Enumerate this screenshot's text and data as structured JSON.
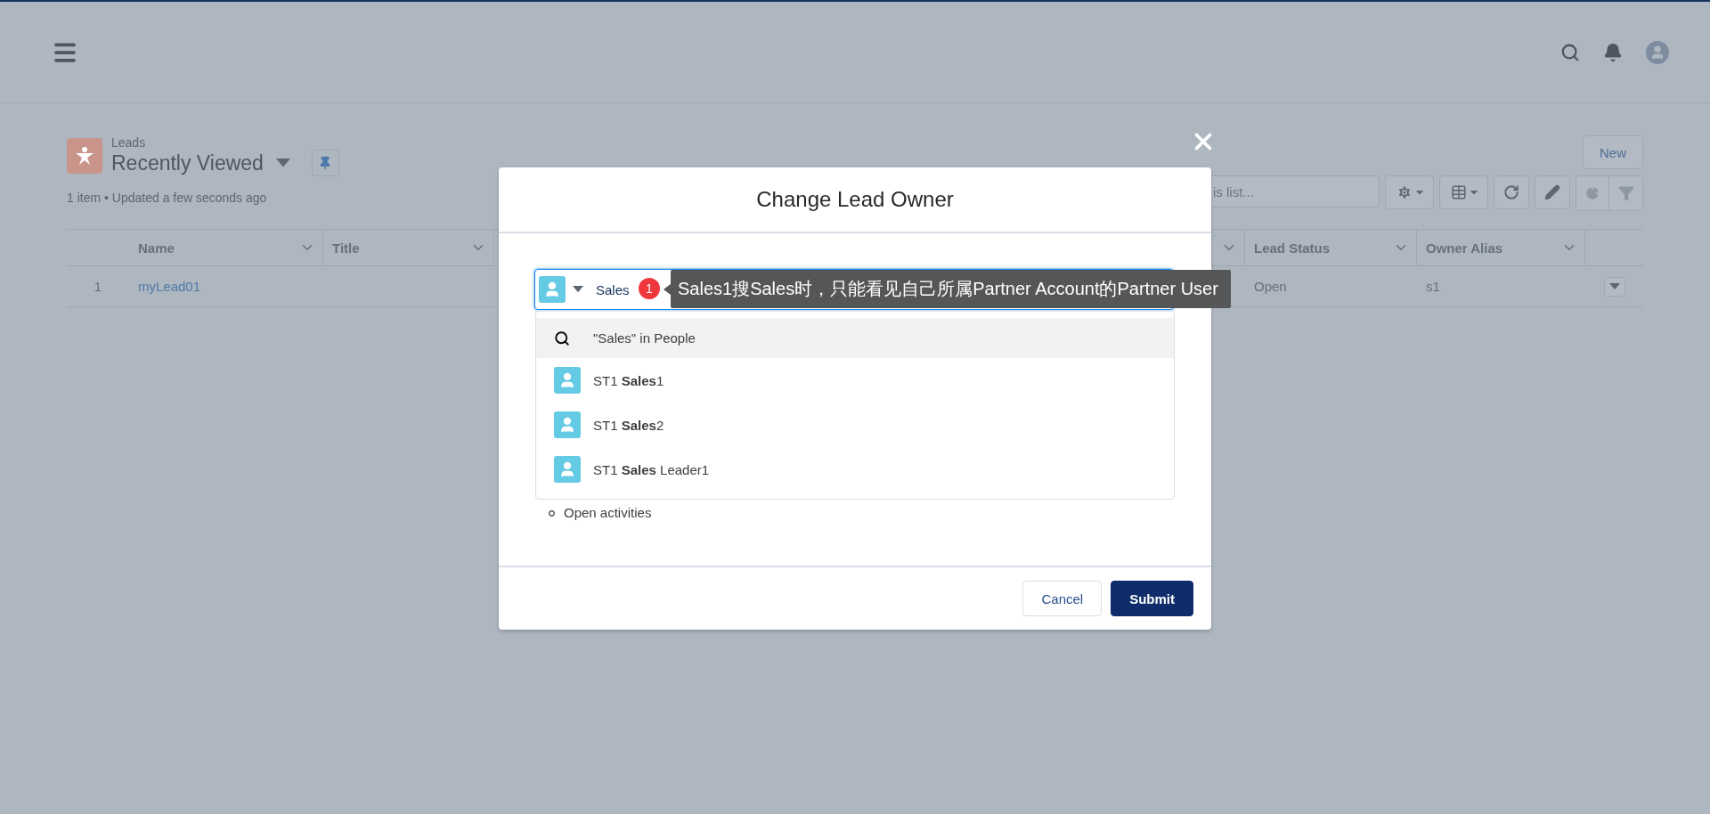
{
  "list_header": {
    "object": "Leads",
    "title": "Recently Viewed",
    "meta": "1 item • Updated a few seconds ago"
  },
  "new_button": "New",
  "list_search": {
    "placeholder": "is list..."
  },
  "table": {
    "columns": [
      {
        "label": "Name"
      },
      {
        "label": "Title"
      },
      {
        "label": "Lead Status"
      },
      {
        "label": "Owner Alias"
      }
    ],
    "rows": [
      {
        "number": "1",
        "name": "myLead01",
        "lead_status": "Open",
        "owner_alias": "s1"
      }
    ]
  },
  "modal": {
    "title": "Change Lead Owner",
    "owner_field": {
      "value": "Sales"
    },
    "suggestions": [
      {
        "kind": "search",
        "label": "\"Sales\" in People",
        "selected": true
      },
      {
        "kind": "person",
        "label": "ST1 **Sales**1",
        "selected": false
      },
      {
        "kind": "person",
        "label": "ST1 **Sales**2",
        "selected": false
      },
      {
        "kind": "person",
        "label": "ST1 **Sales** Leader1",
        "selected": false
      }
    ],
    "bullets": [
      "Open activities"
    ],
    "buttons": [
      {
        "kind": "neutral",
        "label": "Cancel"
      },
      {
        "kind": "brand",
        "label": "Submit"
      }
    ]
  },
  "annotation": {
    "badge": "1",
    "text": "Sales1搜Sales时，只能看见自己所属Partner Account的Partner User"
  }
}
